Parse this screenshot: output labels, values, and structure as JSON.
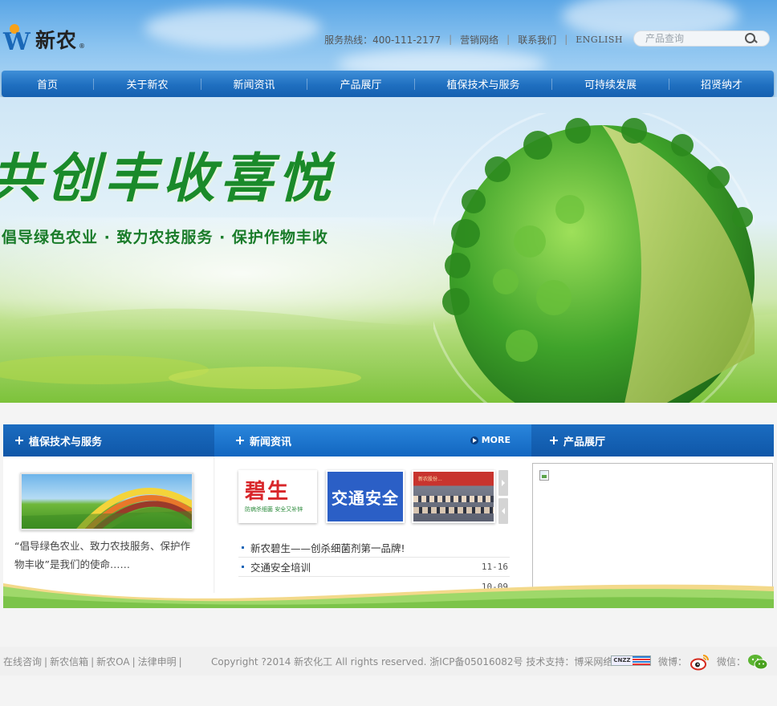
{
  "brand": {
    "name": "新农",
    "reg": "®"
  },
  "toplinks": {
    "hotline": "服务热线：400-111-2177",
    "sales_network": "营销网络",
    "contact": "联系我们",
    "english": "ENGLISH"
  },
  "search": {
    "placeholder": "产品查询"
  },
  "nav": [
    "首页",
    "关于新农",
    "新闻资讯",
    "产品展厅",
    "植保技术与服务",
    "可持续发展",
    "招贤纳才"
  ],
  "banner": {
    "slogan": "共创丰收喜悦",
    "subslogan": "倡导绿色农业 · 致力农技服务 · 保护作物丰收"
  },
  "sections": {
    "service": {
      "title": "植保技术与服务",
      "text": "“倡导绿色农业、致力农技服务、保护作物丰收”是我们的使命……"
    },
    "news": {
      "title": "新闻资讯",
      "more": "MORE",
      "thumbs": [
        {
          "big": "碧生",
          "small": "防病杀细菌  安全又补锌"
        },
        {
          "big": "交通安全"
        },
        {
          "caption": "新农股份..."
        }
      ],
      "items": [
        {
          "title": "新农碧生——创杀细菌剂第一品牌!",
          "date": ""
        },
        {
          "title": "交通安全培训",
          "date": "11-16"
        },
        {
          "title": "",
          "date": "10-09"
        }
      ]
    },
    "products": {
      "title": "产品展厅"
    }
  },
  "footer": {
    "links": [
      "在线咨询",
      "新农信箱",
      "新农OA",
      "法律申明"
    ],
    "copyright": "Copyright ?2014 新农化工 All rights reserved. 浙ICP备05016082号 技术支持：博采网络",
    "cnzz": "CNZZ",
    "weibo_label": "微博：",
    "weixin_label": "微信："
  },
  "colors": {
    "nav_blue": "#1f6fc0",
    "head_blue": "#0f57a8",
    "green_text": "#1a8a2a",
    "logo_orange": "#f7a21b"
  },
  "icons": [
    "search-icon",
    "plus-icon",
    "more-arrow-icon",
    "broken-image-icon",
    "weibo-icon",
    "weixin-icon"
  ]
}
